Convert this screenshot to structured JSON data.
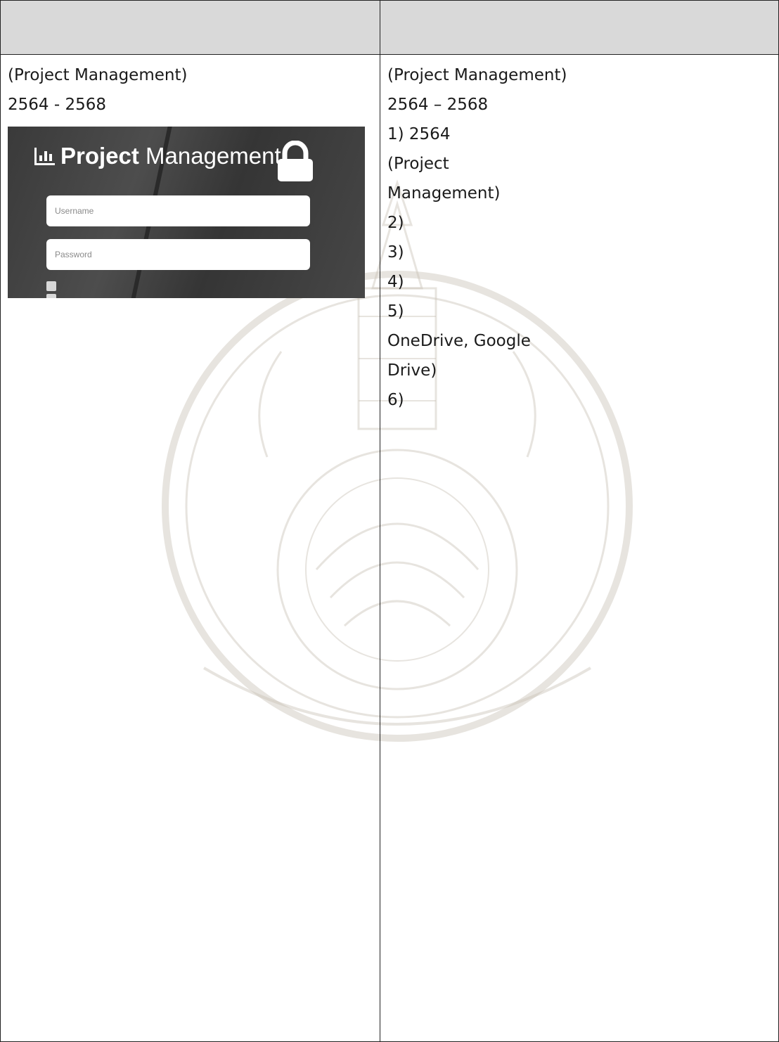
{
  "table": {
    "header_left": "",
    "header_right": ""
  },
  "left": {
    "intro_lines": [
      "",
      "(Project Management)",
      " 2564 - 2568"
    ],
    "screenshot": {
      "brand_bold": "Project",
      "brand_light": " Management",
      "subtitle": "",
      "username_placeholder": "Username",
      "password_placeholder": "Password",
      "accept_label": "",
      "remember_label": ""
    },
    "caption_lines": [
      "",
      "",
      ""
    ]
  },
  "right": {
    "lines": [
      "",
      "(Project Management)",
      " 2564 – 2568",
      "1) 2564",
      "",
      "(Project",
      "Management)",
      "",
      "",
      "2)",
      "",
      "",
      "",
      "",
      "",
      "",
      "3)",
      "",
      "",
      "4)",
      "",
      "",
      "5)",
      "",
      "OneDrive, Google",
      "Drive)",
      "6)",
      ""
    ]
  }
}
